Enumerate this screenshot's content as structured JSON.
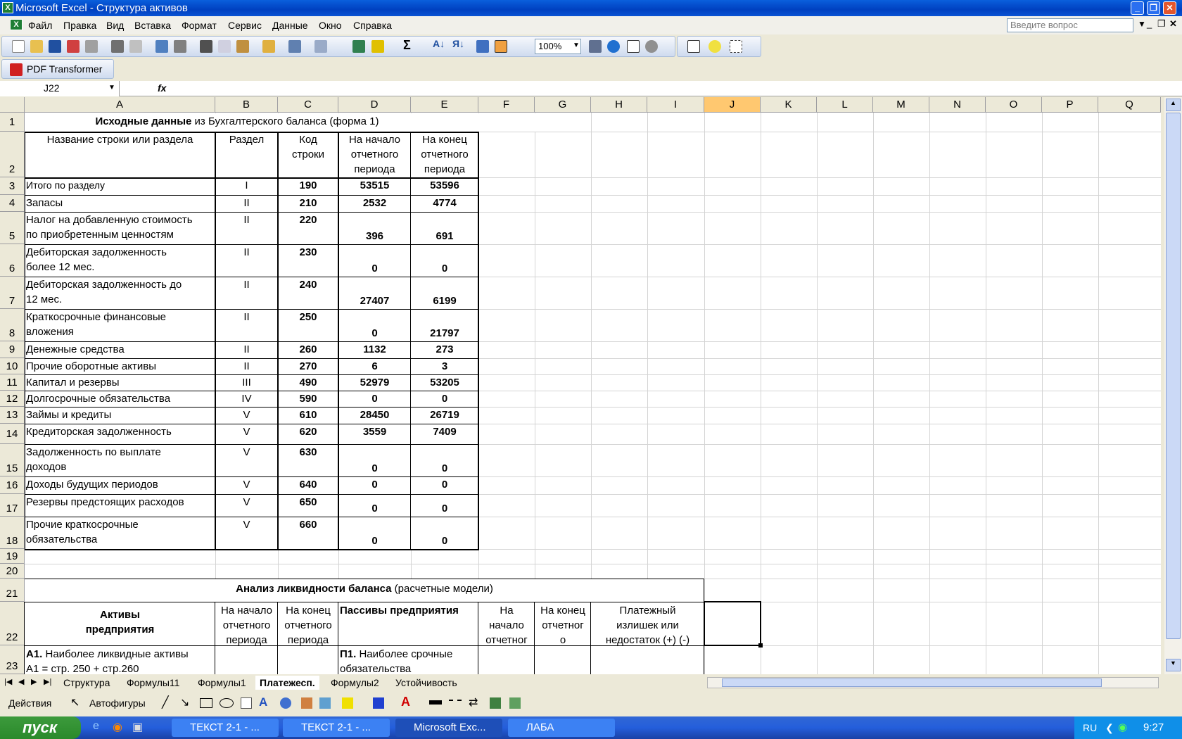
{
  "window": {
    "title": "Microsoft Excel - Структура активов"
  },
  "menu": {
    "items": [
      "Файл",
      "Правка",
      "Вид",
      "Вставка",
      "Формат",
      "Сервис",
      "Данные",
      "Окно",
      "Справка"
    ],
    "help_placeholder": "Введите вопрос"
  },
  "toolbar": {
    "zoom": "100%",
    "pdf_label": "PDF Transformer"
  },
  "formula": {
    "namebox": "J22",
    "fx": "fx"
  },
  "columns": [
    "A",
    "B",
    "C",
    "D",
    "E",
    "F",
    "G",
    "H",
    "I",
    "J",
    "K",
    "L",
    "M",
    "N",
    "O",
    "P",
    "Q"
  ],
  "rows": [
    "1",
    "2",
    "3",
    "4",
    "5",
    "6",
    "7",
    "8",
    "9",
    "10",
    "11",
    "12",
    "13",
    "14",
    "15",
    "16",
    "17",
    "18",
    "19",
    "20",
    "21",
    "22",
    "23"
  ],
  "sheet": {
    "title1_bold": "Исходные данные",
    "title1_rest": " из Бухгалтерского баланса (форма 1)",
    "h_name": "Название строки или раздела",
    "h_section": "Раздел",
    "h_code": "Код\nстроки",
    "h_start": "На начало\nотчетного\nпериода",
    "h_end": "На конец\nотчетного\nпериода",
    "data": [
      {
        "name": "Итого по разделу",
        "sec": "I",
        "code": "190",
        "start": "53515",
        "end": "53596"
      },
      {
        "name": "Запасы",
        "sec": "II",
        "code": "210",
        "start": "2532",
        "end": "4774"
      },
      {
        "name": "Налог на добавленную стоимость\nпо приобретенным ценностям",
        "sec": "II",
        "code": "220",
        "start": "396",
        "end": "691"
      },
      {
        "name": "Дебиторская задолженность\nболее 12 мес.",
        "sec": "II",
        "code": "230",
        "start": "0",
        "end": "0"
      },
      {
        "name": "Дебиторская задолженность до\n12 мес.",
        "sec": "II",
        "code": "240",
        "start": "27407",
        "end": "6199"
      },
      {
        "name": "Краткосрочные финансовые\nвложения",
        "sec": "II",
        "code": "250",
        "start": "0",
        "end": "21797"
      },
      {
        "name": "Денежные средства",
        "sec": "II",
        "code": "260",
        "start": "1132",
        "end": "273"
      },
      {
        "name": "Прочие оборотные активы",
        "sec": "II",
        "code": "270",
        "start": "6",
        "end": "3"
      },
      {
        "name": "Капитал и резервы",
        "sec": "III",
        "code": "490",
        "start": "52979",
        "end": "53205"
      },
      {
        "name": "Долгосрочные обязательства",
        "sec": "IV",
        "code": "590",
        "start": "0",
        "end": "0"
      },
      {
        "name": "Займы и кредиты",
        "sec": "V",
        "code": "610",
        "start": "28450",
        "end": "26719"
      },
      {
        "name": "Кредиторская задолженность",
        "sec": "V",
        "code": "620",
        "start": "3559",
        "end": "7409"
      },
      {
        "name": "Задолженность по выплате\nдоходов",
        "sec": "V",
        "code": "630",
        "start": "0",
        "end": "0"
      },
      {
        "name": "Доходы будущих периодов",
        "sec": "V",
        "code": "640",
        "start": "0",
        "end": "0"
      },
      {
        "name": "Резервы предстоящих расходов",
        "sec": "V",
        "code": "650",
        "start": "0",
        "end": "0"
      },
      {
        "name": "Прочие краткосрочные\nобязательства",
        "sec": "V",
        "code": "660",
        "start": "0",
        "end": "0"
      }
    ],
    "title2_bold": "Анализ ликвидности баланса",
    "title2_rest": " (расчетные модели)",
    "h2_assets": "Активы\nпредприятия",
    "h2_start": "На начало\nотчетного\nпериода",
    "h2_end": "На конец\nотчетного\nпериода",
    "h2_liab": "Пассивы предприятия",
    "h2_lstart": "На\nначало\nотчетног",
    "h2_lend": "На конец\nотчетног\nо",
    "h2_surplus": "Платежный\nизлишек или\nнедостаток (+) (-)",
    "r23_a_bold": "А1.",
    "r23_a_rest": " Наиболее ликвидные активы\nА1 = стр. 250 + стр.260",
    "r23_p_bold": "П1.",
    "r23_p_rest": " Наиболее срочные\nобязательства"
  },
  "tabs": [
    "Структура",
    "Формулы11",
    "Формулы1",
    "Платежесп.",
    "Формулы2",
    "Устойчивость"
  ],
  "drawbar": {
    "actions": "Действия",
    "autoshapes": "Автофигуры"
  },
  "taskbar": {
    "start": "пуск",
    "tasks": [
      "ТЕКСТ 2-1 - ...",
      "ТЕКСТ 2-1 - ...",
      "Microsoft Exc...",
      "ЛАБА"
    ],
    "lang": "RU",
    "time": "9:27"
  }
}
